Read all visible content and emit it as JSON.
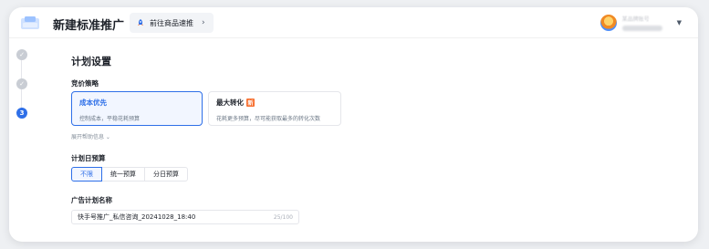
{
  "header": {
    "title": "新建标准推广",
    "goto_label": "前往商品速推",
    "user_name": "某品牌账号"
  },
  "steps": [
    {
      "status": "done",
      "label": "✓"
    },
    {
      "status": "done",
      "label": "✓"
    },
    {
      "status": "active",
      "label": "3"
    }
  ],
  "section_title": "计划设置",
  "bid_strategy": {
    "label": "竞价策略",
    "options": [
      {
        "title": "成本优先",
        "desc": "控制成本，平稳花耗预算",
        "selected": true
      },
      {
        "title": "最大转化",
        "tag": "新",
        "desc": "花耗更多预算，尽可能获取最多的转化次数",
        "selected": false
      }
    ],
    "expand_label": "展开帮助信息 ⌄"
  },
  "daily_budget": {
    "label": "计划日预算",
    "options": [
      "不限",
      "统一预算",
      "分日预算"
    ],
    "selected": "不限"
  },
  "plan_name": {
    "label": "广告计划名称",
    "value": "快手号推广_私信咨询_20241028_18:40",
    "count": "25/100"
  },
  "colors": {
    "accent": "#2e6fe8",
    "accent_bg": "#f2f6ff",
    "text": "#1d2129",
    "muted": "#86909c",
    "tag": "#f77234"
  }
}
